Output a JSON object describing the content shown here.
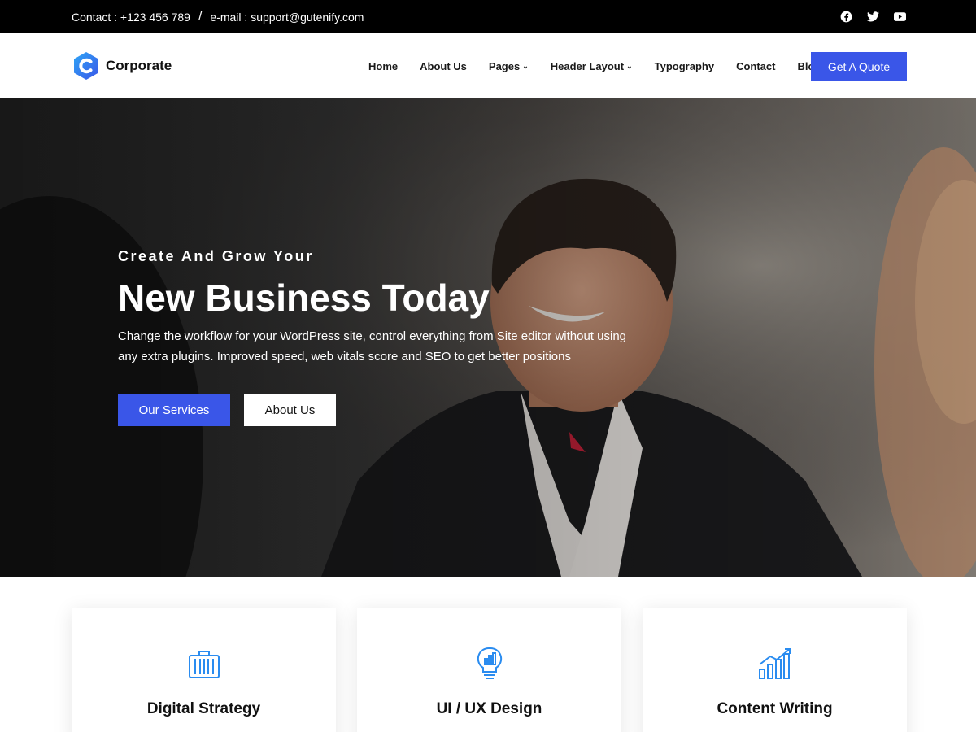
{
  "topbar": {
    "contact": "Contact : +123 456 789",
    "separator": "/",
    "email": "e-mail : support@gutenify.com",
    "social": [
      {
        "icon": "facebook-icon"
      },
      {
        "icon": "twitter-icon"
      },
      {
        "icon": "youtube-icon"
      }
    ]
  },
  "header": {
    "logo_name": "Corporate",
    "nav": [
      {
        "label": "Home",
        "has_dropdown": false
      },
      {
        "label": "About Us",
        "has_dropdown": false
      },
      {
        "label": "Pages",
        "has_dropdown": true
      },
      {
        "label": "Header Layout",
        "has_dropdown": true
      },
      {
        "label": "Typography",
        "has_dropdown": false
      },
      {
        "label": "Contact",
        "has_dropdown": false
      },
      {
        "label": "Blog",
        "has_dropdown": false
      }
    ],
    "caret": "⌄",
    "cta_label": "Get A Quote"
  },
  "hero": {
    "pretitle": "Create And Grow Your",
    "title": "New Business Today",
    "description": "Change the workflow for your WordPress site, control everything from Site editor without using any extra plugins. Improved speed, web vitals score and SEO to get better positions",
    "primary_button": "Our Services",
    "secondary_button": "About Us"
  },
  "services": [
    {
      "title": "Digital Strategy",
      "icon": "briefcase-icon"
    },
    {
      "title": "UI / UX Design",
      "icon": "lightbulb-icon"
    },
    {
      "title": "Content Writing",
      "icon": "growth-chart-icon"
    }
  ],
  "colors": {
    "accent": "#3a56e8",
    "topbar_bg": "#000000",
    "icon_blue": "#2a8cf0"
  }
}
